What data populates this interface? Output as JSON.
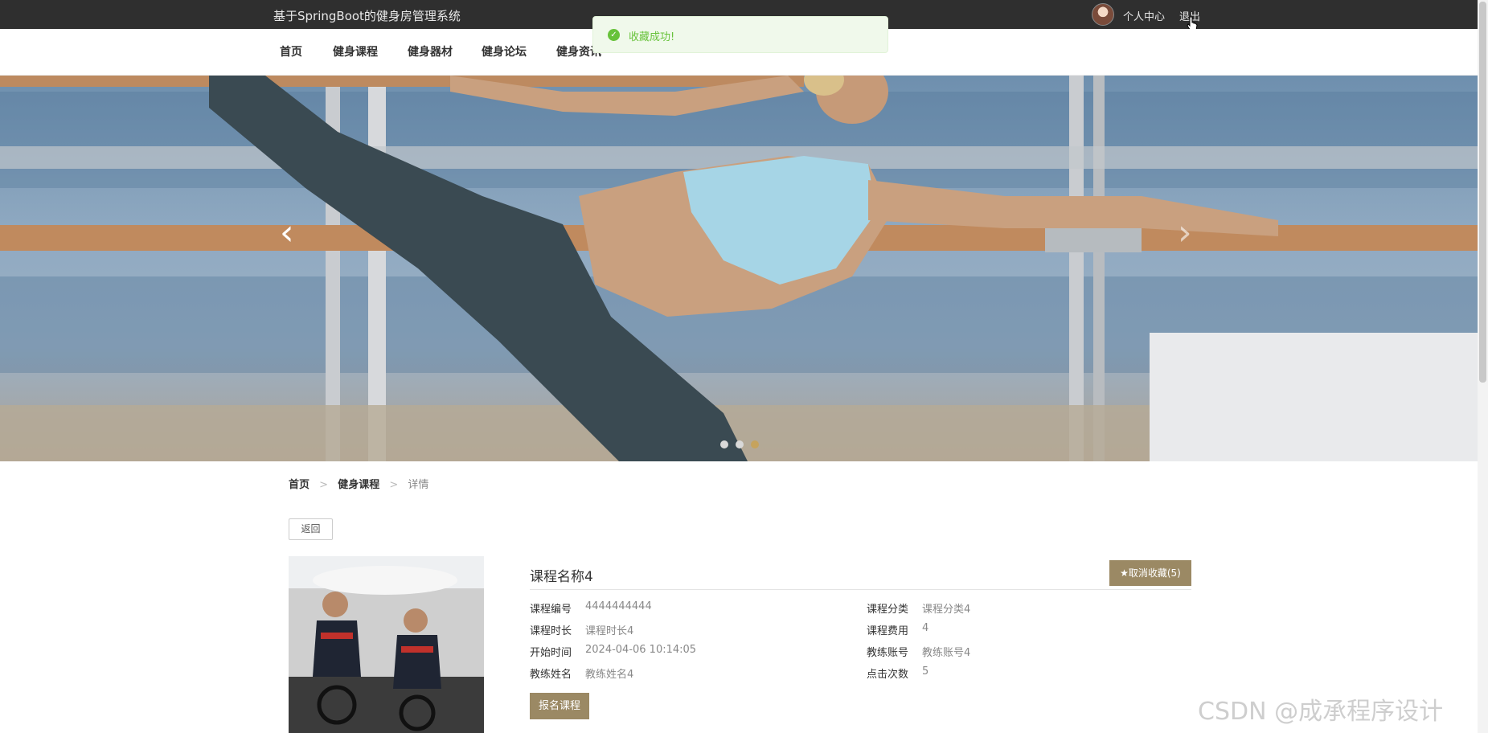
{
  "header": {
    "site_title": "基于SpringBoot的健身房管理系统",
    "user_center": "个人中心",
    "logout": "退出"
  },
  "nav": {
    "items": [
      {
        "label": "首页"
      },
      {
        "label": "健身课程"
      },
      {
        "label": "健身器材"
      },
      {
        "label": "健身论坛"
      },
      {
        "label": "健身资讯"
      }
    ]
  },
  "toast": {
    "message": "收藏成功!",
    "icon": "check-circle-icon",
    "color": "#67c23a"
  },
  "carousel": {
    "prev_icon": "‹",
    "next_icon": "›",
    "active_index": 2,
    "count": 3
  },
  "breadcrumb": {
    "home": "首页",
    "separator": ">",
    "course": "健身课程",
    "current": "详情"
  },
  "back_button": "返回",
  "course": {
    "name": "课程名称4",
    "favorite_button": "★取消收藏(5)",
    "signup_button": "报名课程",
    "fields": {
      "code_label": "课程编号",
      "code_value": "4444444444",
      "category_label": "课程分类",
      "category_value": "课程分类4",
      "duration_label": "课程时长",
      "duration_value": "课程时长4",
      "fee_label": "课程费用",
      "fee_value": "4",
      "start_label": "开始时间",
      "start_value": "2024-04-06 10:14:05",
      "coach_account_label": "教练账号",
      "coach_account_value": "教练账号4",
      "coach_name_label": "教练姓名",
      "coach_name_value": "教练姓名4",
      "clicks_label": "点击次数",
      "clicks_value": "5"
    }
  },
  "watermark": "CSDN @成承程序设计",
  "colors": {
    "accent": "#9b8964",
    "topbar": "#2f2f2f"
  }
}
